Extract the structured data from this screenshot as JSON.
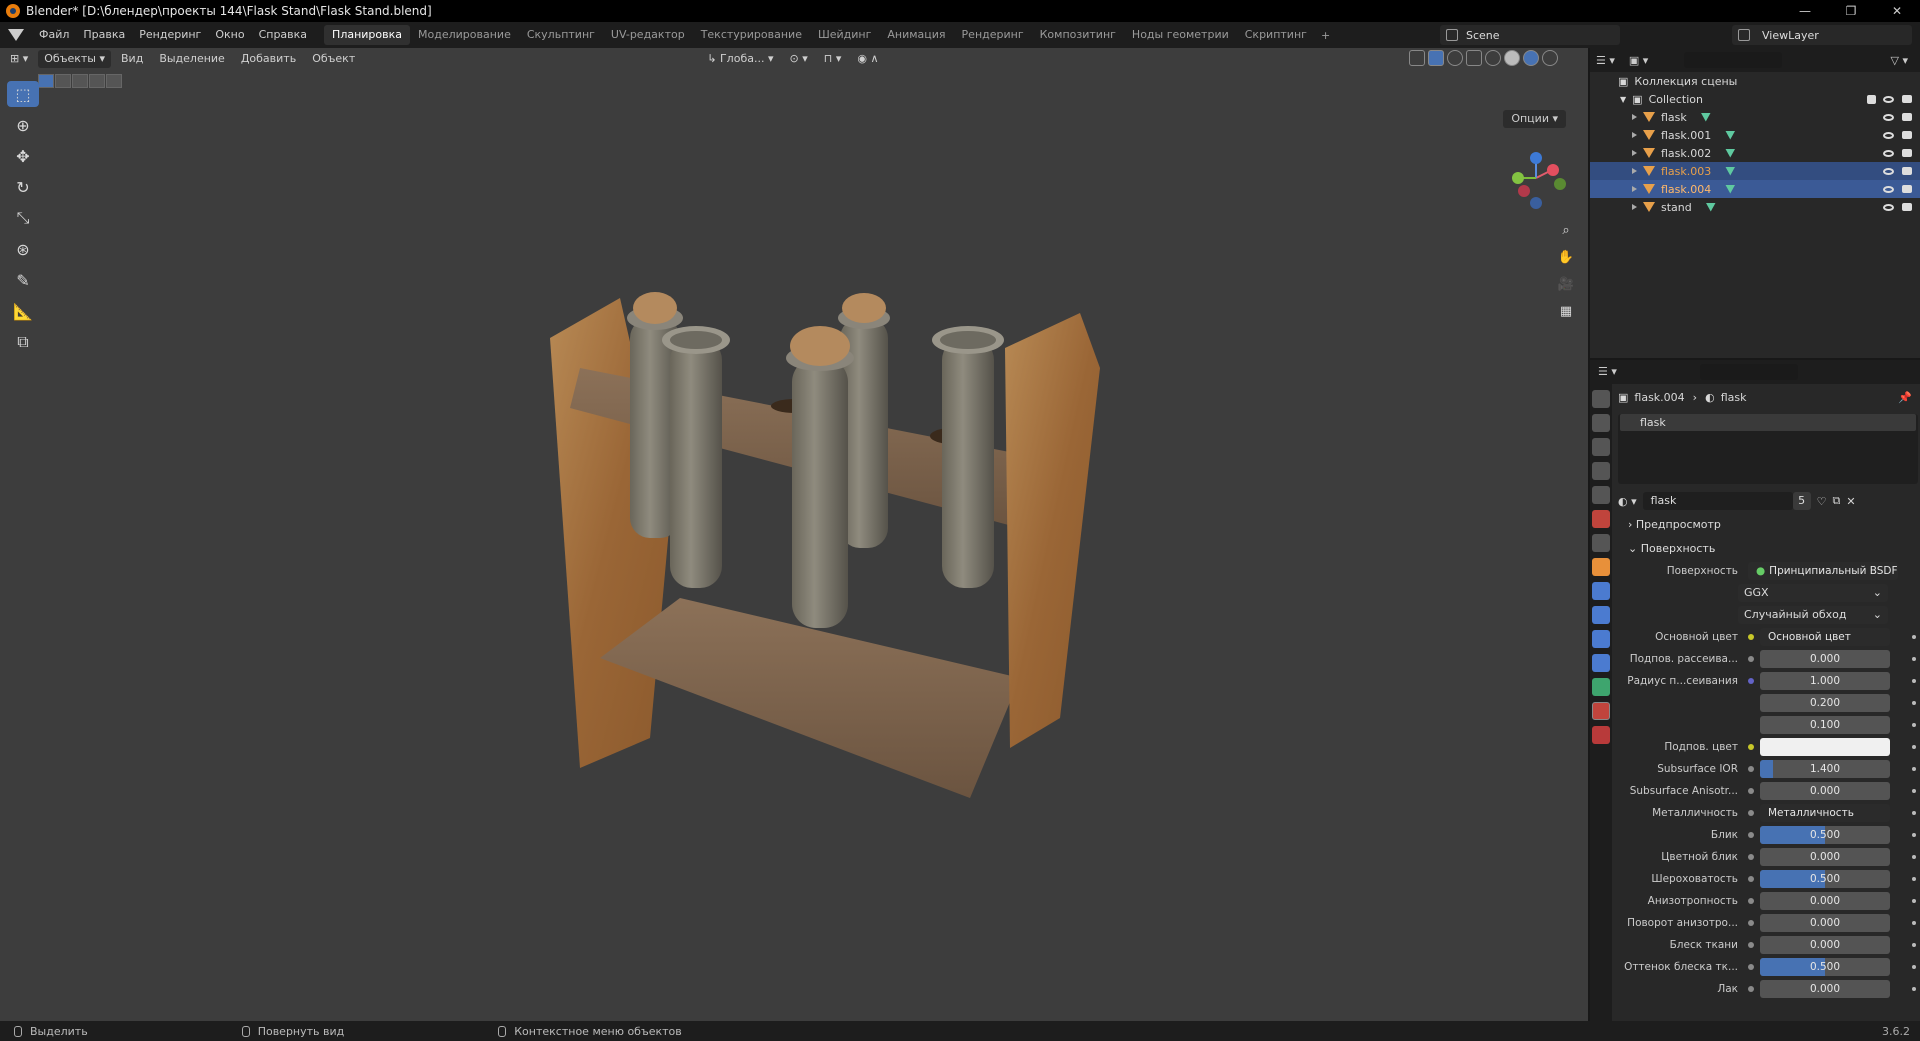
{
  "window": {
    "title": "Blender* [D:\\блендер\\проекты 144\\Flask Stand\\Flask Stand.blend]"
  },
  "menu": {
    "items": [
      "Файл",
      "Правка",
      "Рендеринг",
      "Окно",
      "Справка"
    ]
  },
  "workspaces": {
    "tabs": [
      "Планировка",
      "Моделирование",
      "Скульптинг",
      "UV-редактор",
      "Текстурирование",
      "Шейдинг",
      "Анимация",
      "Рендеринг",
      "Композитинг",
      "Ноды геометрии",
      "Скриптинг"
    ],
    "active": "Планировка"
  },
  "scene": {
    "name": "Scene"
  },
  "view_layer": {
    "name": "ViewLayer"
  },
  "viewport": {
    "mode": "Объекты",
    "header_menus": [
      "Вид",
      "Выделение",
      "Добавить",
      "Объект"
    ],
    "orientation": "Глоба...",
    "options_label": "Опции"
  },
  "outliner": {
    "root": "Коллекция сцены",
    "collection": "Collection",
    "objects": [
      {
        "name": "flask",
        "state": "normal"
      },
      {
        "name": "flask.001",
        "state": "normal"
      },
      {
        "name": "flask.002",
        "state": "normal"
      },
      {
        "name": "flask.003",
        "state": "selected"
      },
      {
        "name": "flask.004",
        "state": "active"
      },
      {
        "name": "stand",
        "state": "normal"
      }
    ]
  },
  "properties": {
    "breadcrumb_object": "flask.004",
    "breadcrumb_material": "flask",
    "slot": "flask",
    "material_name": "flask",
    "material_users": "5",
    "panels": {
      "preview": "Предпросмотр",
      "surface": "Поверхность"
    },
    "surface_label": "Поверхность",
    "surface_value": "Принципиальный BSDF",
    "distribution": "GGX",
    "subsurface_method": "Случайный обход",
    "rows": [
      {
        "label": "Основной цвет",
        "value": "Основной цвет",
        "kind": "link",
        "dot": "#c7c729"
      },
      {
        "label": "Подпов. рассеива...",
        "value": "0.000",
        "kind": "num",
        "fill": 0,
        "dot": "#8a8a8a"
      },
      {
        "label": "Радиус п...сеивания",
        "value": "1.000",
        "kind": "num",
        "fill": 0,
        "dot": "#6363c7"
      },
      {
        "label": "",
        "value": "0.200",
        "kind": "num",
        "fill": 0,
        "dot": ""
      },
      {
        "label": "",
        "value": "0.100",
        "kind": "num",
        "fill": 0,
        "dot": ""
      },
      {
        "label": "Подпов. цвет",
        "value": "",
        "kind": "color",
        "dot": "#c7c729"
      },
      {
        "label": "Subsurface IOR",
        "value": "1.400",
        "kind": "num",
        "fill": 0.1,
        "dot": "#8a8a8a"
      },
      {
        "label": "Subsurface Anisotr...",
        "value": "0.000",
        "kind": "num",
        "fill": 0,
        "dot": "#8a8a8a"
      },
      {
        "label": "Металличность",
        "value": "Металличность",
        "kind": "link",
        "dot": "#8a8a8a"
      },
      {
        "label": "Блик",
        "value": "0.500",
        "kind": "num",
        "fill": 0.5,
        "dot": "#8a8a8a"
      },
      {
        "label": "Цветной блик",
        "value": "0.000",
        "kind": "num",
        "fill": 0,
        "dot": "#8a8a8a"
      },
      {
        "label": "Шероховатость",
        "value": "0.500",
        "kind": "num",
        "fill": 0.5,
        "dot": "#8a8a8a"
      },
      {
        "label": "Анизотропность",
        "value": "0.000",
        "kind": "num",
        "fill": 0,
        "dot": "#8a8a8a"
      },
      {
        "label": "Поворот анизотро...",
        "value": "0.000",
        "kind": "num",
        "fill": 0,
        "dot": "#8a8a8a"
      },
      {
        "label": "Блеск ткани",
        "value": "0.000",
        "kind": "num",
        "fill": 0,
        "dot": "#8a8a8a"
      },
      {
        "label": "Оттенок блеска тк...",
        "value": "0.500",
        "kind": "num",
        "fill": 0.5,
        "dot": "#8a8a8a"
      },
      {
        "label": "Лак",
        "value": "0.000",
        "kind": "num",
        "fill": 0,
        "dot": "#8a8a8a"
      }
    ]
  },
  "statusbar": {
    "items": [
      "Выделить",
      "Повернуть вид",
      "Контекстное меню объектов"
    ],
    "version": "3.6.2"
  },
  "colors": {
    "accent": "#4772b3",
    "viewport_bg": "#3d3d3d",
    "wood": "#a4703c"
  }
}
